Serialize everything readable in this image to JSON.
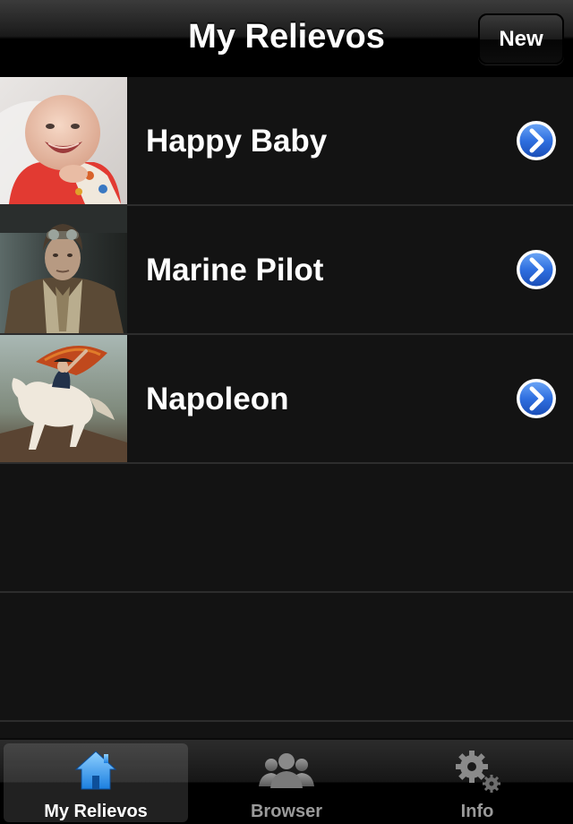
{
  "nav": {
    "title": "My Relievos",
    "new_button_label": "New"
  },
  "rows": [
    {
      "label": "Happy Baby",
      "thumbnail": "happy-baby-photo",
      "accessory": "detail-disclosure-icon"
    },
    {
      "label": "Marine Pilot",
      "thumbnail": "marine-pilot-photo",
      "accessory": "detail-disclosure-icon"
    },
    {
      "label": "Napoleon",
      "thumbnail": "napoleon-painting",
      "accessory": "detail-disclosure-icon"
    }
  ],
  "tabs": [
    {
      "label": "My Relievos",
      "icon": "house-icon",
      "selected": true
    },
    {
      "label": "Browser",
      "icon": "people-icon",
      "selected": false
    },
    {
      "label": "Info",
      "icon": "gears-icon",
      "selected": false
    }
  ],
  "colors": {
    "background": "#131313",
    "accent_blue": "#2f6fe0",
    "tab_selected_label": "#ffffff",
    "tab_label": "#9a9a9a"
  }
}
